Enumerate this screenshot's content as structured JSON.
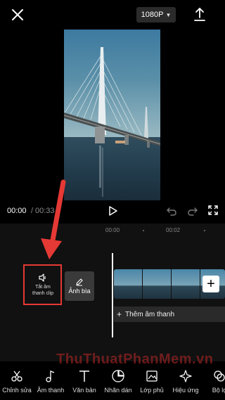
{
  "header": {
    "resolution": "1080P",
    "close_icon": "close-icon",
    "export_icon": "export-icon"
  },
  "player": {
    "current_time": "00:00",
    "separator": "/",
    "total_time": "00:33"
  },
  "timeline": {
    "ruler": [
      "00:00",
      "00:02"
    ]
  },
  "side_actions": {
    "mute_label": "Tắt âm\nthanh clip",
    "cover_label": "Ảnh bìa"
  },
  "audio": {
    "add_label": "Thêm âm thanh"
  },
  "toolbar": {
    "items": [
      "Chỉnh sửa",
      "Âm thanh",
      "Văn bản",
      "Nhãn dán",
      "Lớp phủ",
      "Hiệu ứng",
      "Bộ lọ"
    ]
  },
  "watermark": {
    "text": "ThuThuatPhanMem.vn"
  },
  "colors": {
    "highlight": "#e53935",
    "background": "#000000"
  }
}
